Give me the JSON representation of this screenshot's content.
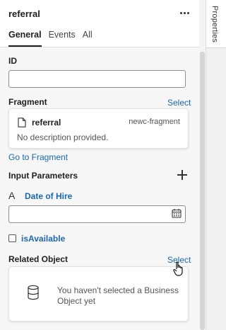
{
  "panel": {
    "title": "referral",
    "menu_icon": "more-horizontal-icon"
  },
  "tabs": [
    {
      "label": "General",
      "active": true
    },
    {
      "label": "Events",
      "active": false
    },
    {
      "label": "All",
      "active": false
    }
  ],
  "right_rail": {
    "tab_label": "Properties"
  },
  "id_field": {
    "label": "ID",
    "value": ""
  },
  "fragment": {
    "label": "Fragment",
    "select_label": "Select",
    "name": "referral",
    "tag": "newc-fragment",
    "description": "No description provided.",
    "icon": "document-icon",
    "go_link": "Go to Fragment"
  },
  "input_parameters": {
    "label": "Input Parameters",
    "add_icon": "plus-icon",
    "params": [
      {
        "type_icon": "text-type-icon",
        "type_glyph": "A",
        "name": "Date of Hire",
        "value": "",
        "trailing_icon": "calendar-icon"
      }
    ],
    "checkbox": {
      "label": "isAvailable",
      "checked": false
    }
  },
  "related_object": {
    "label": "Related Object",
    "select_label": "Select",
    "empty_icon": "database-icon",
    "empty_text": "You haven't selected a Business Object yet"
  },
  "colors": {
    "link": "#1a66b8",
    "text": "#1f1f1f",
    "muted": "#555555",
    "panel_bg": "#f7f7f7"
  }
}
